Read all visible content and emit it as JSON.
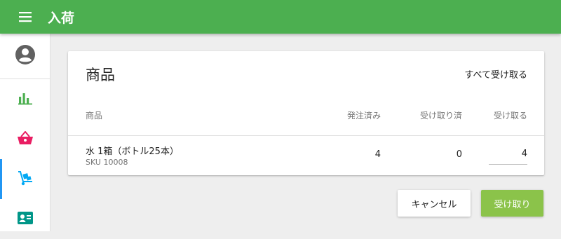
{
  "header": {
    "title": "入荷",
    "menu_icon": "hamburger-menu-icon",
    "background_color": "#4caf50"
  },
  "sidebar": {
    "accent_color": "#2196f3",
    "items": [
      {
        "icon": "account-circle-icon",
        "active": false,
        "color": "#616161"
      },
      {
        "icon": "bar-chart-icon",
        "active": false,
        "color": "#4caf50"
      },
      {
        "icon": "shopping-basket-icon",
        "active": false,
        "color": "#e91e63"
      },
      {
        "icon": "hand-truck-icon",
        "active": true,
        "color": "#03a9f4"
      },
      {
        "icon": "contact-card-icon",
        "active": false,
        "color": "#009688"
      }
    ]
  },
  "card": {
    "title": "商品",
    "receive_all_label": "すべて受け取る",
    "columns": {
      "product": "商品",
      "ordered": "発注済み",
      "received": "受け取り済",
      "receive": "受け取る"
    },
    "rows": [
      {
        "name": "水 1箱（ボトル25本）",
        "sku": "SKU 10008",
        "ordered": "4",
        "received": "0",
        "receive_value": "4"
      }
    ]
  },
  "actions": {
    "cancel_label": "キャンセル",
    "receive_label": "受け取り",
    "receive_color": "#8bc34a"
  }
}
